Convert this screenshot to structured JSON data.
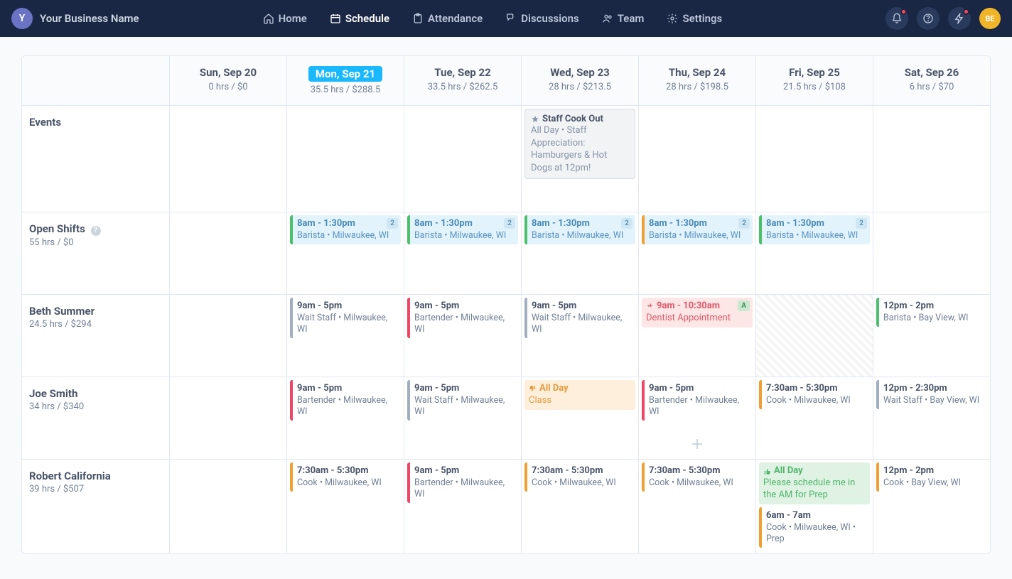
{
  "brand": {
    "initial": "Y",
    "name": "Your Business Name"
  },
  "nav": {
    "home": "Home",
    "schedule": "Schedule",
    "attendance": "Attendance",
    "discussions": "Discussions",
    "team": "Team",
    "settings": "Settings"
  },
  "user": {
    "initials": "BE"
  },
  "days": [
    {
      "label": "Sun, Sep 20",
      "stats": "0 hrs / $0",
      "today": false
    },
    {
      "label": "Mon, Sep 21",
      "stats": "35.5 hrs / $288.5",
      "today": true
    },
    {
      "label": "Tue, Sep 22",
      "stats": "33.5 hrs / $262.5",
      "today": false
    },
    {
      "label": "Wed, Sep 23",
      "stats": "28 hrs / $213.5",
      "today": false
    },
    {
      "label": "Thu, Sep 24",
      "stats": "28 hrs / $198.5",
      "today": false
    },
    {
      "label": "Fri, Sep 25",
      "stats": "21.5 hrs / $108",
      "today": false
    },
    {
      "label": "Sat, Sep 26",
      "stats": "6 hrs / $70",
      "today": false
    }
  ],
  "rows": {
    "events": {
      "title": "Events",
      "wed": {
        "title": "Staff Cook Out",
        "desc": "All Day • Staff Appreciation: Hamburgers & Hot Dogs at 12pm!"
      }
    },
    "open_shifts": {
      "title": "Open Shifts",
      "sub": "55 hrs / $0",
      "card": {
        "time": "8am - 1:30pm",
        "detail": "Barista • Milwaukee, WI",
        "count": "2"
      }
    },
    "beth": {
      "title": "Beth Summer",
      "sub": "24.5 hrs / $294",
      "mon": {
        "time": "9am - 5pm",
        "detail": "Wait Staff • Milwaukee, WI"
      },
      "tue": {
        "time": "9am - 5pm",
        "detail": "Bartender • Milwaukee, WI"
      },
      "wed": {
        "time": "9am - 5pm",
        "detail": "Wait Staff • Milwaukee, WI"
      },
      "thu": {
        "time": "9am - 10:30am",
        "detail": "Dentist Appointment",
        "badge": "A"
      },
      "sat": {
        "time": "12pm - 2pm",
        "detail": "Barista • Bay View, WI"
      }
    },
    "joe": {
      "title": "Joe Smith",
      "sub": "34 hrs / $340",
      "mon": {
        "time": "9am - 5pm",
        "detail": "Bartender • Milwaukee, WI"
      },
      "tue": {
        "time": "9am - 5pm",
        "detail": "Wait Staff • Milwaukee, WI"
      },
      "wed": {
        "time": "All Day",
        "detail": "Class"
      },
      "thu": {
        "time": "9am - 5pm",
        "detail": "Bartender • Milwaukee, WI"
      },
      "fri": {
        "time": "7:30am - 5:30pm",
        "detail": "Cook • Milwaukee, WI"
      },
      "sat": {
        "time": "12pm - 2:30pm",
        "detail": "Wait Staff • Bay View, WI"
      }
    },
    "robert": {
      "title": "Robert California",
      "sub": "39 hrs / $507",
      "mon": {
        "time": "7:30am - 5:30pm",
        "detail": "Cook • Milwaukee, WI"
      },
      "tue": {
        "time": "9am - 5pm",
        "detail": "Bartender • Milwaukee, WI"
      },
      "wed": {
        "time": "7:30am - 5:30pm",
        "detail": "Cook • Milwaukee, WI"
      },
      "thu": {
        "time": "7:30am - 5:30pm",
        "detail": "Cook • Milwaukee, WI"
      },
      "fri_pref": {
        "time": "All Day",
        "detail": "Please schedule me in the AM for Prep"
      },
      "fri": {
        "time": "6am - 7am",
        "detail": "Cook • Milwaukee, WI • Prep"
      },
      "sat": {
        "time": "12pm - 2pm",
        "detail": "Cook • Bay View, WI"
      }
    }
  }
}
